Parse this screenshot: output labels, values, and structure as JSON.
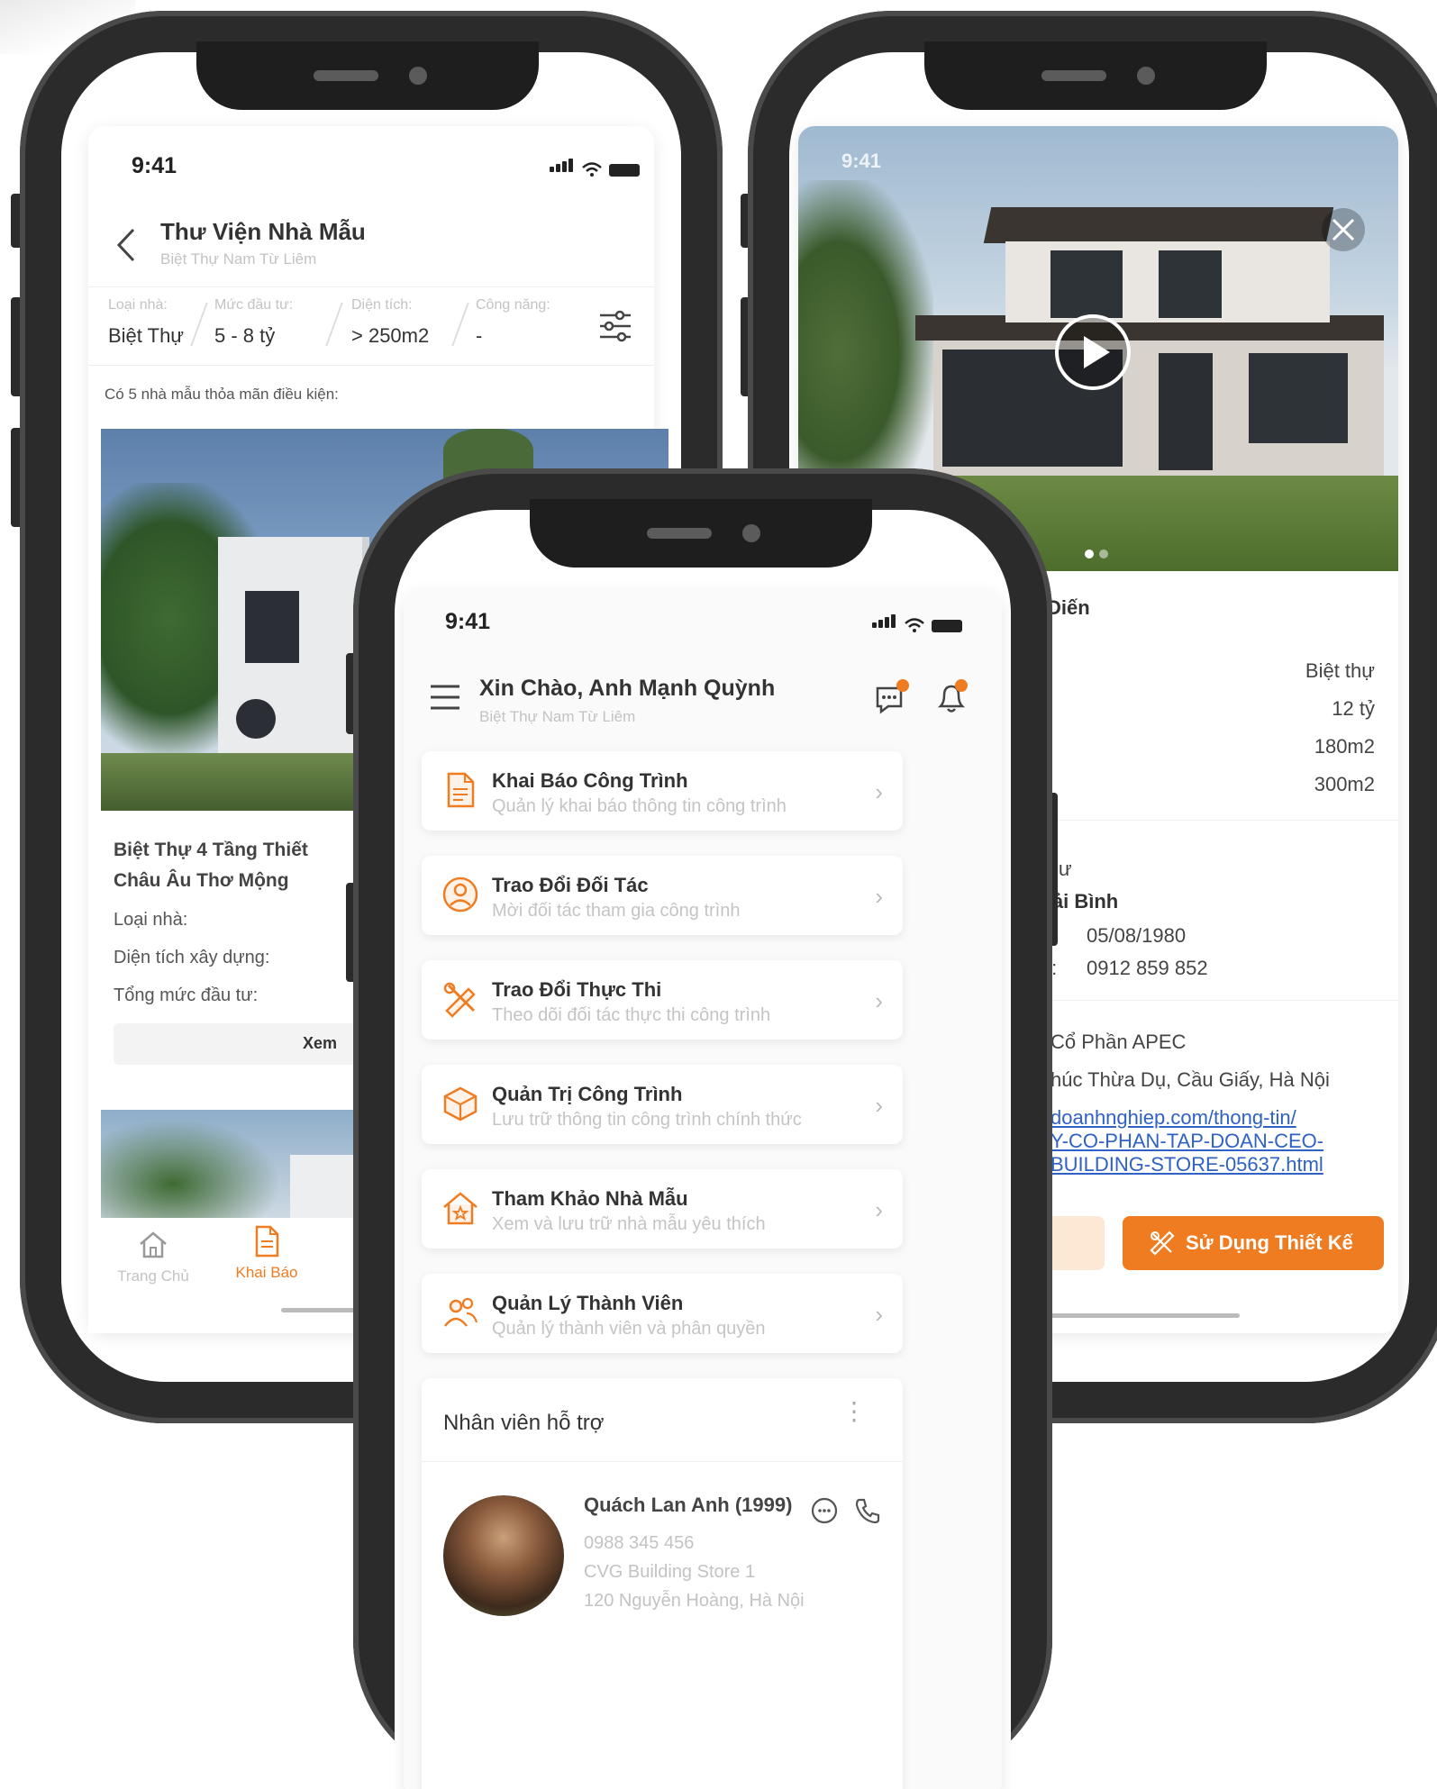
{
  "left_screen": {
    "time": "9:41",
    "header": {
      "title": "Thư Viện Nhà Mẫu",
      "subtitle": "Biệt Thự Nam Từ Liêm"
    },
    "filters": [
      {
        "label": "Loại nhà:",
        "value": "Biệt Thự"
      },
      {
        "label": "Mức đầu tư:",
        "value": "5 - 8 tỷ"
      },
      {
        "label": "Diện tích:",
        "value": "> 250m2"
      },
      {
        "label": "Công năng:",
        "value": "-"
      }
    ],
    "result_text": "Có 5 nhà mẫu thỏa mãn điều kiện:",
    "listing": {
      "title_line1": "Biệt Thự 4 Tầng Thiết",
      "title_line2": "Châu Âu Thơ Mộng",
      "row1": "Loại nhà:",
      "row2": "Diện tích xây dựng:",
      "row3": "Tổng mức đầu tư:",
      "button": "Xem"
    },
    "bottom_nav": [
      {
        "label": "Trang Chủ",
        "icon": "home-icon"
      },
      {
        "label": "Khai Báo",
        "icon": "document-icon"
      }
    ]
  },
  "right_screen": {
    "time": "9:41",
    "section_title_partial": "Diến",
    "specs": [
      "Biệt thự",
      "12 tỷ",
      "180m2",
      "300m2"
    ],
    "architect": {
      "role_partial": ": Sư",
      "name_partial": "Hải Bình",
      "dob_label_partial": "h:",
      "dob": "05/08/1980",
      "phone_label_partial": "ại:",
      "phone": "0912 859 852"
    },
    "company": {
      "name_partial": "Cổ Phần APEC",
      "address_partial": "húc Thừa Dụ, Cầu Giấy, Hà Nội",
      "link_line1": "doanhnghiep.com/thong-tin/",
      "link_line2": "Y-CO-PHAN-TAP-DOAN-CEO-",
      "link_line3": "BUILDING-STORE-05637.html"
    },
    "use_design_button": "Sử Dụng Thiết Kế",
    "accent_color": "#f07c22"
  },
  "front_screen": {
    "time": "9:41",
    "header": {
      "title": "Xin Chào, Anh Mạnh Quỳnh",
      "subtitle": "Biệt Thự Nam Từ Liêm"
    },
    "menu": [
      {
        "title": "Khai Báo Công Trình",
        "subtitle": "Quản lý khai báo thông tin công trình",
        "icon": "document-icon"
      },
      {
        "title": "Trao Đổi Đối Tác",
        "subtitle": "Mời đối tác tham gia công trình",
        "icon": "user-circle-icon"
      },
      {
        "title": "Trao Đổi Thực Thi",
        "subtitle": "Theo dõi đối tác thực thi công trình",
        "icon": "tools-icon"
      },
      {
        "title": "Quản Trị Công Trình",
        "subtitle": "Lưu trữ thông tin công trình chính thức",
        "icon": "box-icon"
      },
      {
        "title": "Tham Khảo Nhà Mẫu",
        "subtitle": "Xem và lưu trữ nhà mẫu yêu thích",
        "icon": "house-icon"
      },
      {
        "title": "Quản Lý Thành Viên",
        "subtitle": "Quản lý thành viên và phân quyền",
        "icon": "users-icon"
      }
    ],
    "support": {
      "title": "Nhân viên hỗ trợ",
      "name": "Quách Lan Anh (1999)",
      "phone": "0988 345 456",
      "store": "CVG Building Store 1",
      "address": "120 Nguyễn Hoàng, Hà Nội"
    }
  }
}
